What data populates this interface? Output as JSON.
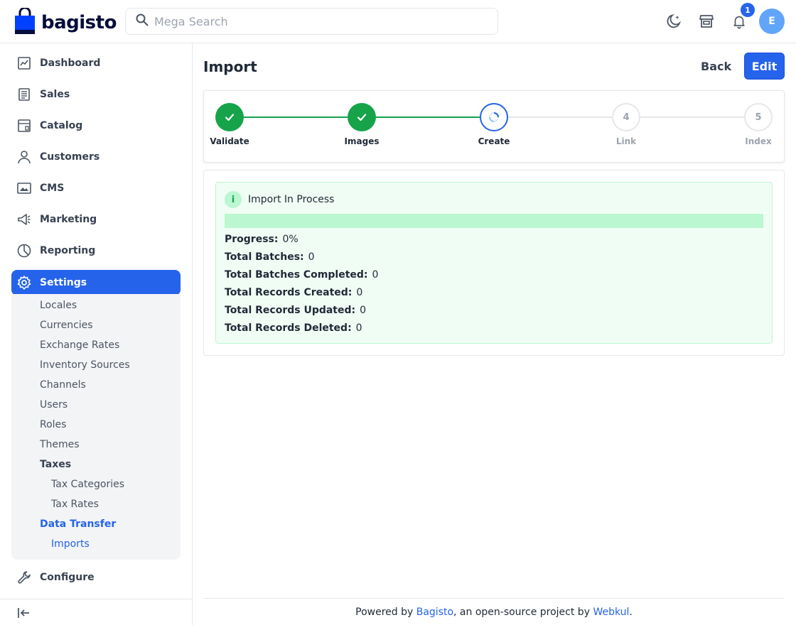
{
  "header": {
    "logo_text": "bagisto",
    "search_placeholder": "Mega Search",
    "notification_count": "1",
    "avatar_initial": "E",
    "icons": [
      "search-icon",
      "dark-mode-icon",
      "storefront-icon",
      "bell-icon"
    ]
  },
  "sidebar": {
    "items": [
      {
        "label": "Dashboard",
        "icon": "dashboard-icon"
      },
      {
        "label": "Sales",
        "icon": "sales-icon"
      },
      {
        "label": "Catalog",
        "icon": "catalog-icon"
      },
      {
        "label": "Customers",
        "icon": "customers-icon"
      },
      {
        "label": "CMS",
        "icon": "cms-icon"
      },
      {
        "label": "Marketing",
        "icon": "marketing-icon"
      },
      {
        "label": "Reporting",
        "icon": "reporting-icon"
      },
      {
        "label": "Settings",
        "icon": "settings-icon",
        "active": true
      },
      {
        "label": "Configure",
        "icon": "configure-icon"
      }
    ],
    "settings_submenu": [
      {
        "label": "Locales"
      },
      {
        "label": "Currencies"
      },
      {
        "label": "Exchange Rates"
      },
      {
        "label": "Inventory Sources"
      },
      {
        "label": "Channels"
      },
      {
        "label": "Users"
      },
      {
        "label": "Roles"
      },
      {
        "label": "Themes"
      },
      {
        "label": "Taxes",
        "expanded": true
      },
      {
        "label": "Tax Categories",
        "level": 2
      },
      {
        "label": "Tax Rates",
        "level": 2
      },
      {
        "label": "Data Transfer",
        "active": true
      },
      {
        "label": "Imports",
        "level": 2,
        "active": true
      }
    ]
  },
  "main": {
    "title": "Import",
    "back_label": "Back",
    "edit_label": "Edit",
    "steps": [
      {
        "label": "Validate",
        "state": "done"
      },
      {
        "label": "Images",
        "state": "done"
      },
      {
        "label": "Create",
        "state": "current"
      },
      {
        "label": "Link",
        "number": "4",
        "state": "pending"
      },
      {
        "label": "Index",
        "number": "5",
        "state": "pending"
      }
    ],
    "status": {
      "info_icon": "i",
      "title": "Import In Process",
      "progress_fraction": 0,
      "stats": [
        {
          "label": "Progress:",
          "value": "0%"
        },
        {
          "label": "Total Batches:",
          "value": "0"
        },
        {
          "label": "Total Batches Completed:",
          "value": "0"
        },
        {
          "label": "Total Records Created:",
          "value": "0"
        },
        {
          "label": "Total Records Updated:",
          "value": "0"
        },
        {
          "label": "Total Records Deleted:",
          "value": "0"
        }
      ]
    }
  },
  "footer": {
    "prefix": "Powered by ",
    "link1": "Bagisto",
    "middle": ", an open-source project by ",
    "link2": "Webkul",
    "suffix": "."
  },
  "colors": {
    "primary": "#2563eb",
    "success": "#16a34a",
    "status_bg": "#f0fdf4",
    "progress_track": "#bbf7d0"
  }
}
